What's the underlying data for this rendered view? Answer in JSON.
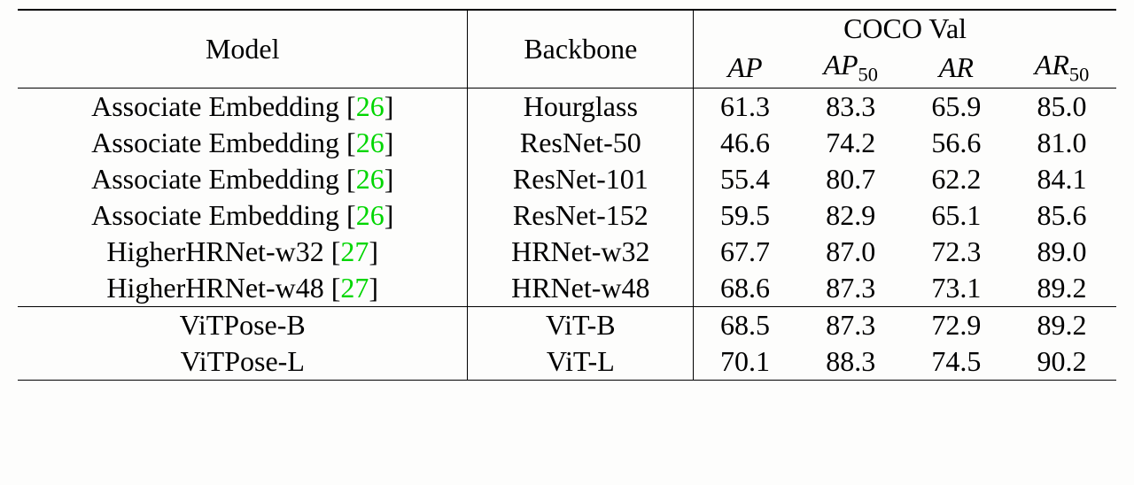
{
  "chart_data": {
    "type": "table",
    "header_group": "COCO Val",
    "columns": [
      "Model",
      "Backbone",
      "AP",
      "AP50",
      "AR",
      "AR50"
    ],
    "rows": [
      {
        "model": "Associate Embedding",
        "cite": "26",
        "backbone": "Hourglass",
        "AP": 61.3,
        "AP50": 83.3,
        "AR": 65.9,
        "AR50": 85.0
      },
      {
        "model": "Associate Embedding",
        "cite": "26",
        "backbone": "ResNet-50",
        "AP": 46.6,
        "AP50": 74.2,
        "AR": 56.6,
        "AR50": 81.0
      },
      {
        "model": "Associate Embedding",
        "cite": "26",
        "backbone": "ResNet-101",
        "AP": 55.4,
        "AP50": 80.7,
        "AR": 62.2,
        "AR50": 84.1
      },
      {
        "model": "Associate Embedding",
        "cite": "26",
        "backbone": "ResNet-152",
        "AP": 59.5,
        "AP50": 82.9,
        "AR": 65.1,
        "AR50": 85.6
      },
      {
        "model": "HigherHRNet-w32",
        "cite": "27",
        "backbone": "HRNet-w32",
        "AP": 67.7,
        "AP50": 87.0,
        "AR": 72.3,
        "AR50": 89.0
      },
      {
        "model": "HigherHRNet-w48",
        "cite": "27",
        "backbone": "HRNet-w48",
        "AP": 68.6,
        "AP50": 87.3,
        "AR": 73.1,
        "AR50": 89.2
      },
      {
        "model": "ViTPose-B",
        "cite": "",
        "backbone": "ViT-B",
        "AP": 68.5,
        "AP50": 87.3,
        "AR": 72.9,
        "AR50": 89.2
      },
      {
        "model": "ViTPose-L",
        "cite": "",
        "backbone": "ViT-L",
        "AP": 70.1,
        "AP50": 88.3,
        "AR": 74.5,
        "AR50": 90.2
      }
    ],
    "section_break_after_row": 5
  },
  "h": {
    "model": "Model",
    "backbone": "Backbone",
    "group": "COCO Val",
    "ap": "AP",
    "ap50_a": "AP",
    "ap50_b": "50",
    "ar": "AR",
    "ar50_a": "AR",
    "ar50_b": "50"
  }
}
